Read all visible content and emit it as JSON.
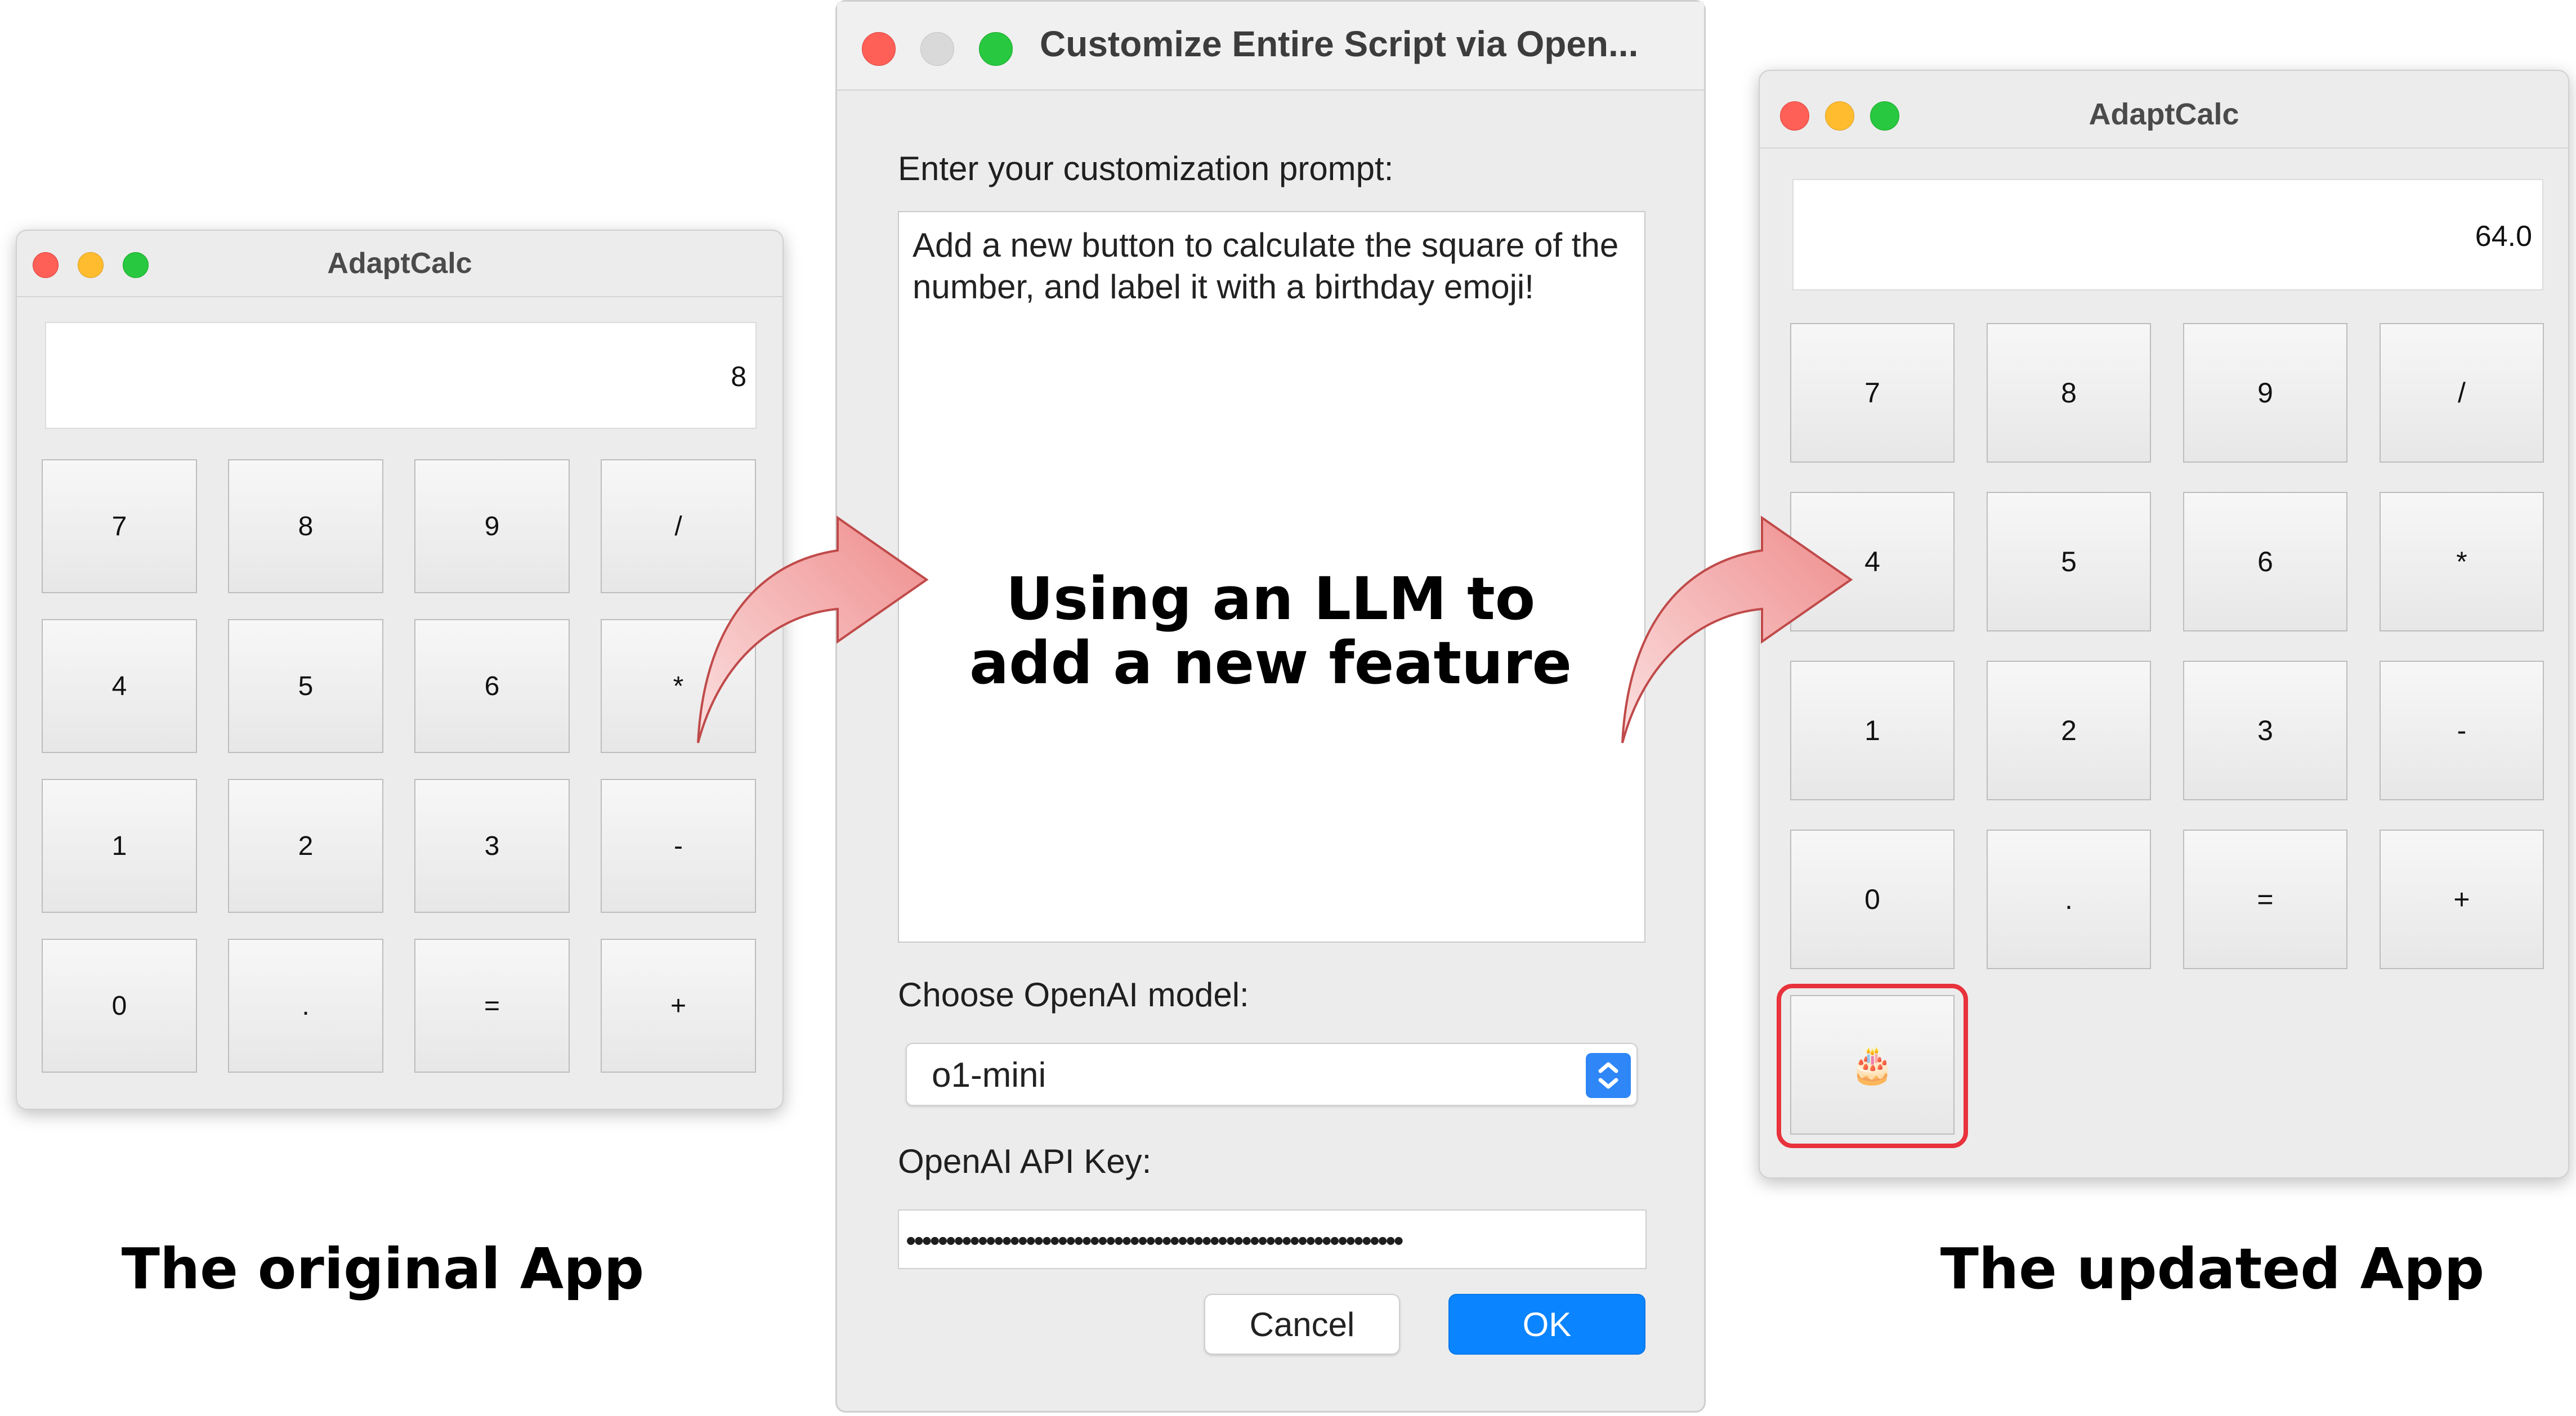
{
  "left_app": {
    "title": "AdaptCalc",
    "display_value": "8",
    "keys": [
      "7",
      "8",
      "9",
      "/",
      "4",
      "5",
      "6",
      "*",
      "1",
      "2",
      "3",
      "-",
      "0",
      ".",
      "=",
      "+"
    ]
  },
  "dialog": {
    "title": "Customize Entire Script via Open...",
    "prompt_label": "Enter your customization prompt:",
    "prompt_text": "Add a new button to calculate the square of the number, and label it with a birthday emoji!",
    "overlay_line1": "Using an LLM to",
    "overlay_line2": "add a new feature",
    "model_label": "Choose OpenAI model:",
    "model_value": "o1-mini",
    "api_key_label": "OpenAI API Key:",
    "api_key_value": "••••••••••••••••••••••••••••••••••••••••••••••••••••••••••••••",
    "cancel_label": "Cancel",
    "ok_label": "OK"
  },
  "right_app": {
    "title": "AdaptCalc",
    "display_value": "64.0",
    "keys": [
      "7",
      "8",
      "9",
      "/",
      "4",
      "5",
      "6",
      "*",
      "1",
      "2",
      "3",
      "-",
      "0",
      ".",
      "=",
      "+"
    ],
    "new_key": "🎂"
  },
  "captions": {
    "left": "The original App",
    "right": "The updated App"
  },
  "colors": {
    "highlight": "#e8323c",
    "arrow": "#f4a3a3",
    "ok_button": "#0a84ff"
  }
}
